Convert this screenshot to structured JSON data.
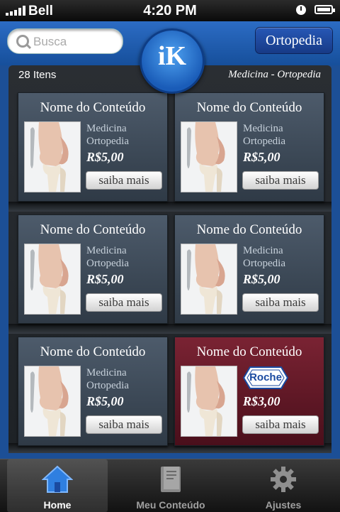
{
  "status_bar": {
    "carrier": "Bell",
    "time": "4:20 PM"
  },
  "header": {
    "search_placeholder": "Busca",
    "category_label": "Ortopedia",
    "logo_text": "iK"
  },
  "listing": {
    "count": "28 Itens",
    "breadcrumb": "Medicina - Ortopedia"
  },
  "items": [
    {
      "title": "Nome do Conteúdo",
      "category": "Medicina",
      "subcategory": "Ortopedia",
      "price": "R$5,00",
      "button": "saiba mais"
    },
    {
      "title": "Nome do Conteúdo",
      "category": "Medicina",
      "subcategory": "Ortopedia",
      "price": "R$5,00",
      "button": "saiba mais"
    },
    {
      "title": "Nome do Conteúdo",
      "category": "Medicina",
      "subcategory": "Ortopedia",
      "price": "R$5,00",
      "button": "saiba mais"
    },
    {
      "title": "Nome do Conteúdo",
      "category": "Medicina",
      "subcategory": "Ortopedia",
      "price": "R$5,00",
      "button": "saiba mais"
    },
    {
      "title": "Nome do Conteúdo",
      "category": "Medicina",
      "subcategory": "Ortopedia",
      "price": "R$5,00",
      "button": "saiba mais"
    },
    {
      "title": "Nome do Conteúdo",
      "sponsor": "Roche",
      "price": "R$3,00",
      "button": "saiba mais"
    }
  ],
  "tabbar": {
    "tabs": [
      {
        "label": "Home",
        "icon": "home-icon",
        "active": true
      },
      {
        "label": "Meu Conteúdo",
        "icon": "book-icon",
        "active": false
      },
      {
        "label": "Ajustes",
        "icon": "gear-icon",
        "active": false
      }
    ]
  },
  "colors": {
    "accent": "#1a5cb8",
    "promo": "#7a2333",
    "card": "#4d5b6b"
  }
}
